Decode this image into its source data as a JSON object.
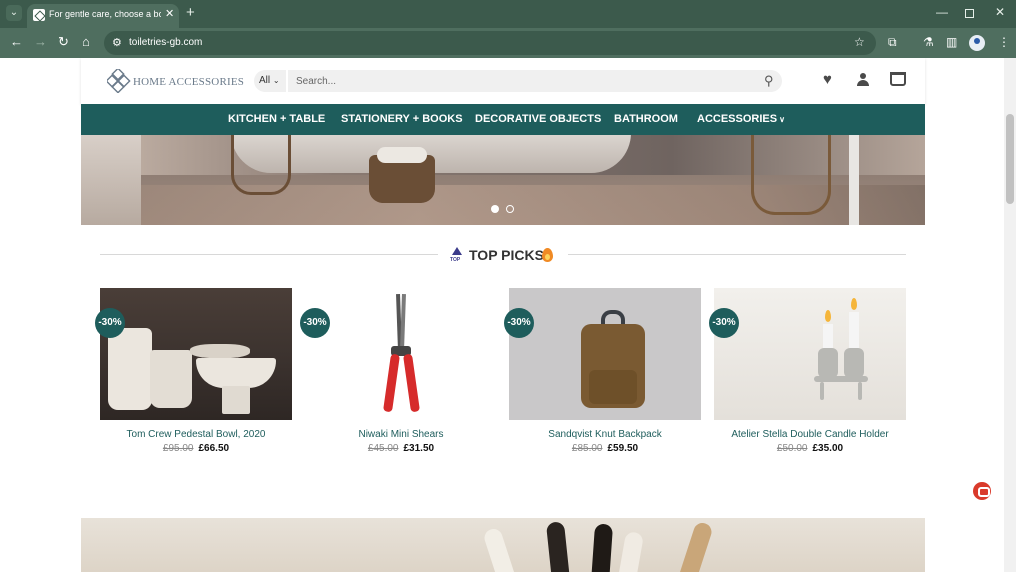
{
  "browser": {
    "tab_title": "For gentle care, choose a body",
    "url": "toiletries-gb.com"
  },
  "header": {
    "logo_text": "HOME ACCESSORIES",
    "category_select": "All",
    "search_placeholder": "Search..."
  },
  "nav": {
    "items": [
      {
        "label": "KITCHEN + TABLE"
      },
      {
        "label": "STATIONERY + BOOKS"
      },
      {
        "label": "DECORATIVE OBJECTS"
      },
      {
        "label": "BATHROOM"
      },
      {
        "label": "ACCESSORIES"
      }
    ]
  },
  "section": {
    "title": "TOP PICKS"
  },
  "products": [
    {
      "badge": "-30%",
      "name": "Tom Crew Pedestal Bowl, 2020",
      "old_price": "£95.00",
      "price": "£66.50"
    },
    {
      "badge": "-30%",
      "name": "Niwaki Mini Shears",
      "old_price": "£45.00",
      "price": "£31.50"
    },
    {
      "badge": "-30%",
      "name": "Sandqvist Knut Backpack",
      "old_price": "£85.00",
      "price": "£59.50"
    },
    {
      "badge": "-30%",
      "name": "Atelier Stella Double Candle Holder",
      "old_price": "£50.00",
      "price": "£35.00"
    }
  ],
  "colors": {
    "brand_teal": "#1e5d5c",
    "chrome_green": "#4f6e5f",
    "accent_red": "#d93a2b"
  }
}
